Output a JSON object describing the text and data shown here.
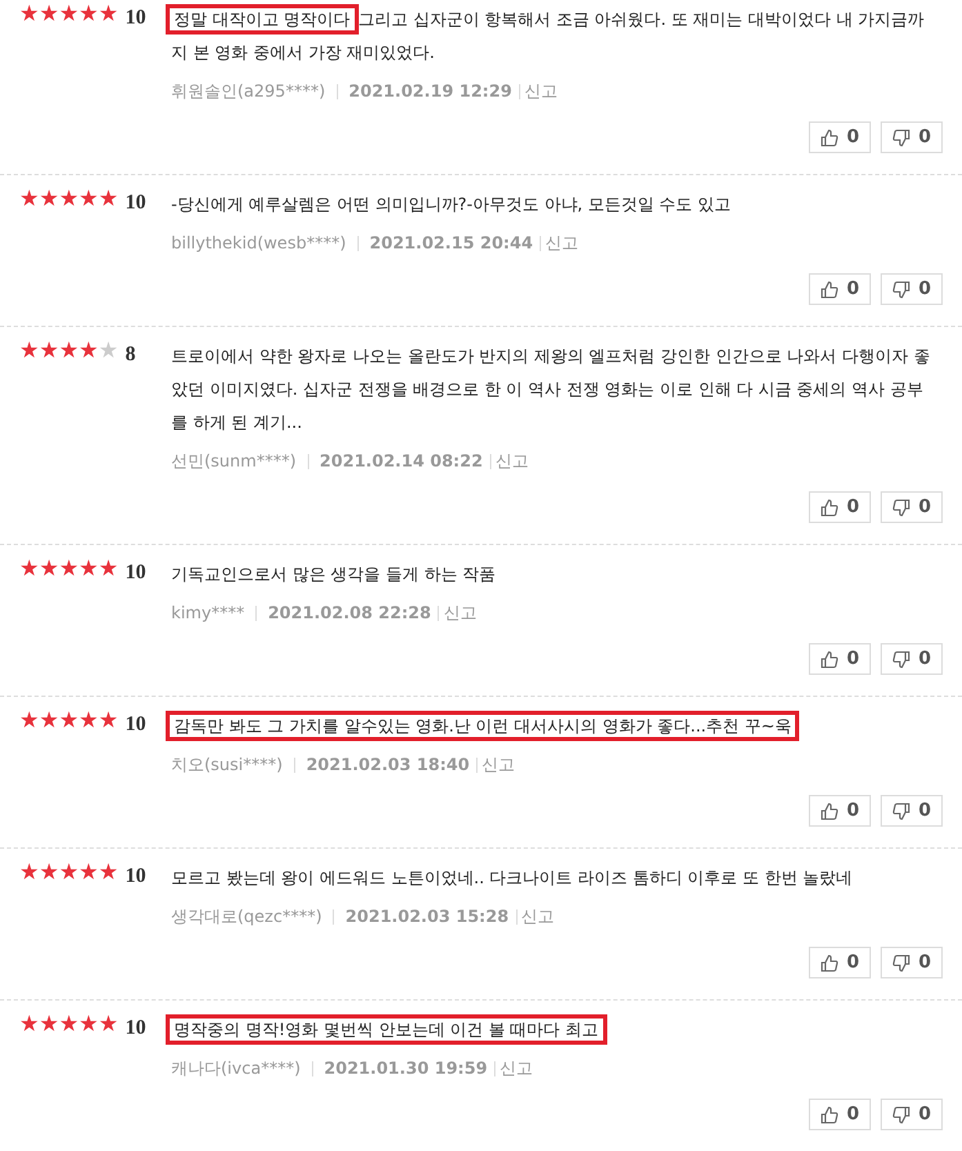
{
  "reviews": [
    {
      "stars": 5,
      "score": "10",
      "text_parts": [
        {
          "text": "정말 대작이고 명작이다",
          "boxed": true
        },
        {
          "text": " 그리고 십자군이 항복해서 조금 아쉬웠다. 또 재미는 대박이었다 내 가지금까지 본 영화 중에서 가장 재미있었다.",
          "boxed": false
        }
      ],
      "author": "휘원솔인(a295****)",
      "date": "2021.02.19 12:29",
      "report": "신고",
      "likes": "0",
      "dislikes": "0"
    },
    {
      "stars": 5,
      "score": "10",
      "text_parts": [
        {
          "text": "-당신에게 예루살렘은 어떤 의미입니까?-아무것도 아냐, 모든것일 수도 있고",
          "boxed": false
        }
      ],
      "author": "billythekid(wesb****)",
      "date": "2021.02.15 20:44",
      "report": "신고",
      "likes": "0",
      "dislikes": "0"
    },
    {
      "stars": 4,
      "score": "8",
      "text_parts": [
        {
          "text": "트로이에서 약한 왕자로 나오는 올란도가 반지의 제왕의 엘프처럼 강인한 인간으로 나와서 다행이자 좋았던 이미지였다. 십자군 전쟁을 배경으로 한 이 역사 전쟁 영화는 이로 인해 다 시금 중세의 역사 공부를 하게 된 계기...",
          "boxed": false
        }
      ],
      "author": "선민(sunm****)",
      "date": "2021.02.14 08:22",
      "report": "신고",
      "likes": "0",
      "dislikes": "0"
    },
    {
      "stars": 5,
      "score": "10",
      "text_parts": [
        {
          "text": "기독교인으로서 많은 생각을 들게 하는 작품",
          "boxed": false
        }
      ],
      "author": "kimy****",
      "date": "2021.02.08 22:28",
      "report": "신고",
      "likes": "0",
      "dislikes": "0"
    },
    {
      "stars": 5,
      "score": "10",
      "text_parts": [
        {
          "text": "감독만 봐도 그 가치를 알수있는 영화.난 이런 대서사시의 영화가 좋다...추천 꾸~욱",
          "boxed": true
        }
      ],
      "author": "치오(susi****)",
      "date": "2021.02.03 18:40",
      "report": "신고",
      "likes": "0",
      "dislikes": "0"
    },
    {
      "stars": 5,
      "score": "10",
      "text_parts": [
        {
          "text": "모르고 봤는데 왕이 에드워드 노튼이었네.. 다크나이트 라이즈 톰하디 이후로 또 한번 놀랐네",
          "boxed": false
        }
      ],
      "author": "생각대로(qezc****)",
      "date": "2021.02.03 15:28",
      "report": "신고",
      "likes": "0",
      "dislikes": "0"
    },
    {
      "stars": 5,
      "score": "10",
      "text_parts": [
        {
          "text": "명작중의 명작!영화 몇번씩 안보는데 이건 볼 때마다 최고",
          "boxed": true
        }
      ],
      "author": "캐나다(ivca****)",
      "date": "2021.01.30 19:59",
      "report": "신고",
      "likes": "0",
      "dislikes": "0"
    }
  ]
}
